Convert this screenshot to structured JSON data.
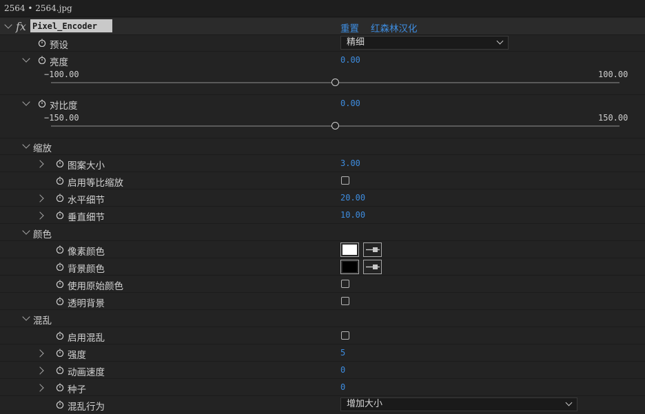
{
  "window": {
    "title": "2564 • 2564.jpg"
  },
  "effect": {
    "name": "Pixel_Encoder",
    "fx_icon": "fx",
    "reset_label": "重置",
    "credit_label": "红森林汉化"
  },
  "preset": {
    "label": "预设",
    "value": "精细"
  },
  "brightness": {
    "label": "亮度",
    "value": "0.00",
    "min_label": "−100.00",
    "max_label": "100.00",
    "min": -100,
    "max": 100,
    "current": 0
  },
  "contrast": {
    "label": "对比度",
    "value": "0.00",
    "min_label": "−150.00",
    "max_label": "150.00",
    "min": -150,
    "max": 150,
    "current": 0
  },
  "scale_group": {
    "label": "缩放",
    "pattern_size": {
      "label": "图案大小",
      "value": "3.00"
    },
    "uniform_scale": {
      "label": "启用等比缩放",
      "checked": false
    },
    "horizontal_detail": {
      "label": "水平细节",
      "value": "20.00"
    },
    "vertical_detail": {
      "label": "垂直细节",
      "value": "10.00"
    }
  },
  "color_group": {
    "label": "颜色",
    "pixel_color": {
      "label": "像素颜色",
      "color": "#ffffff"
    },
    "background_color": {
      "label": "背景颜色",
      "color": "#000000"
    },
    "use_original": {
      "label": "使用原始颜色",
      "checked": false
    },
    "transparent_bg": {
      "label": "透明背景",
      "checked": false
    }
  },
  "chaos_group": {
    "label": "混乱",
    "enable": {
      "label": "启用混乱",
      "checked": false
    },
    "intensity": {
      "label": "强度",
      "value": "5"
    },
    "anim_speed": {
      "label": "动画速度",
      "value": "0"
    },
    "seed": {
      "label": "种子",
      "value": "0"
    },
    "behavior": {
      "label": "混乱行为",
      "value": "增加大小"
    }
  },
  "colors": {
    "accent": "#3e8de0",
    "panel": "#232323"
  }
}
